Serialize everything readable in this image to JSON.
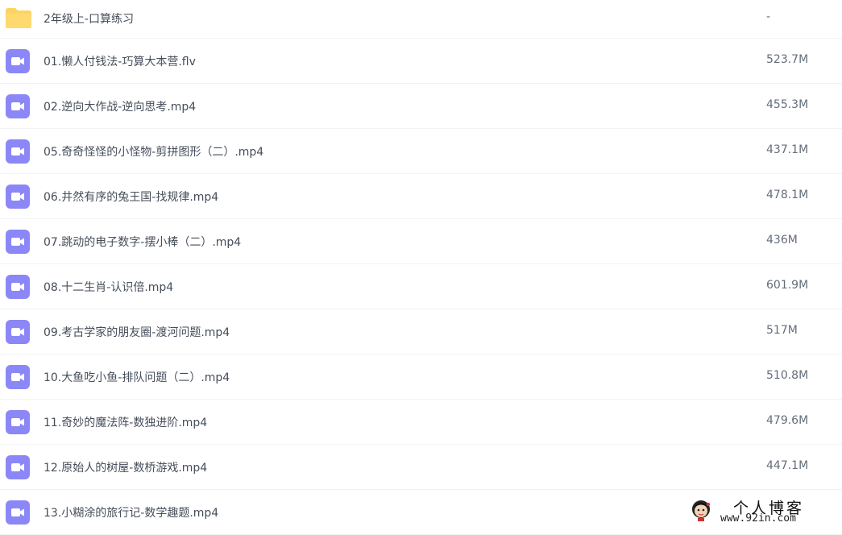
{
  "colors": {
    "folder": "#fcd461",
    "video_icon": "#8b87f7",
    "text": "#454d5a",
    "size_text": "#656d7a"
  },
  "folder": {
    "name": "2年级上-口算练习",
    "size": "-",
    "icon": "folder-icon"
  },
  "files": [
    {
      "name": "01.懒人付钱法-巧算大本营.flv",
      "size": "523.7M",
      "icon": "video-icon"
    },
    {
      "name": "02.逆向大作战-逆向思考.mp4",
      "size": "455.3M",
      "icon": "video-icon"
    },
    {
      "name": "05.奇奇怪怪的小怪物-剪拼图形（二）.mp4",
      "size": "437.1M",
      "icon": "video-icon"
    },
    {
      "name": "06.井然有序的兔王国-找规律.mp4",
      "size": "478.1M",
      "icon": "video-icon"
    },
    {
      "name": "07.跳动的电子数字-摆小棒（二）.mp4",
      "size": "436M",
      "icon": "video-icon"
    },
    {
      "name": "08.十二生肖-认识倍.mp4",
      "size": "601.9M",
      "icon": "video-icon"
    },
    {
      "name": "09.考古学家的朋友圈-渡河问题.mp4",
      "size": "517M",
      "icon": "video-icon"
    },
    {
      "name": "10.大鱼吃小鱼-排队问题（二）.mp4",
      "size": "510.8M",
      "icon": "video-icon"
    },
    {
      "name": "11.奇妙的魔法阵-数独进阶.mp4",
      "size": "479.6M",
      "icon": "video-icon"
    },
    {
      "name": "12.原始人的树屋-数桥游戏.mp4",
      "size": "447.1M",
      "icon": "video-icon"
    },
    {
      "name": "13.小糊涂的旅行记-数学趣题.mp4",
      "size": "",
      "icon": "video-icon"
    }
  ],
  "watermark": {
    "title": "个人博客",
    "url": "www.92in.com"
  }
}
